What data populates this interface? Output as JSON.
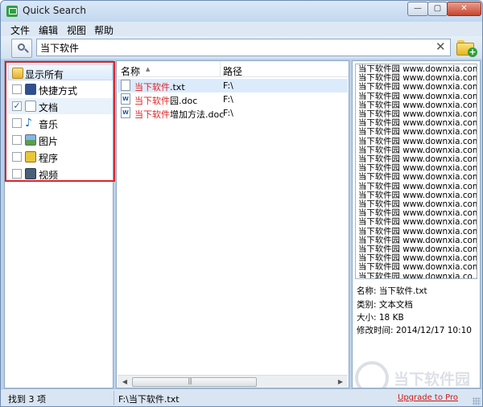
{
  "window": {
    "title": "Quick Search"
  },
  "window_buttons": {
    "min": "—",
    "max": "▢",
    "close": "✕"
  },
  "menu": [
    "文件",
    "编辑",
    "视图",
    "帮助"
  ],
  "search": {
    "value": "当下软件"
  },
  "categories": [
    {
      "label": "显示所有",
      "icon": "folder-icon",
      "checked": false
    },
    {
      "label": "快捷方式",
      "icon": "shortcut-icon",
      "checked": false
    },
    {
      "label": "文档",
      "icon": "document-icon",
      "checked": true
    },
    {
      "label": "音乐",
      "icon": "music-icon",
      "checked": false
    },
    {
      "label": "图片",
      "icon": "picture-icon",
      "checked": false
    },
    {
      "label": "程序",
      "icon": "program-icon",
      "checked": false
    },
    {
      "label": "视频",
      "icon": "video-icon",
      "checked": false
    }
  ],
  "results": {
    "col_name": "名称",
    "col_path": "路径",
    "rows": [
      {
        "highlight": "当下软件",
        "rest": ".txt",
        "path": "F:\\",
        "type": "txt",
        "selected": true
      },
      {
        "highlight": "当下软件",
        "rest": "园.doc",
        "path": "F:\\",
        "type": "doc",
        "selected": false
      },
      {
        "highlight": "当下软件",
        "rest": "增加方法.doc",
        "path": "F:\\",
        "type": "doc",
        "selected": false
      }
    ]
  },
  "preview": {
    "lines": [
      "当下软件园 www.downxia.com",
      "当下软件园 www.downxia.com",
      "当下软件园 www.downxia.com",
      "当下软件园 www.downxia.com",
      "当下软件园 www.downxia.com",
      "当下软件园 www.downxia.com",
      "当下软件园 www.downxia.com",
      "当下软件园 www.downxia.com",
      "当下软件园 www.downxia.com",
      "当下软件园 www.downxia.com",
      "当下软件园 www.downxia.com",
      "当下软件园 www.downxia.com",
      "当下软件园 www.downxia.com",
      "当下软件园 www.downxia.com",
      "当下软件园 www.downxia.com",
      "当下软件园 www.downxia.com",
      "当下软件园 www.downxia.com",
      "当下软件园 www.downxia.com",
      "当下软件园 www.downxia.com",
      "当下软件园 www.downxia.com",
      "当下软件园 www.downxia.com",
      "当下软件园 www.downxia.com",
      "当下软件园 www.downxia.com",
      "当下软件园 www.downxia.co..."
    ]
  },
  "info": [
    "名称: 当下软件.txt",
    "类别: 文本文档",
    "大小: 18 KB",
    "修改时间: 2014/12/17 10:10"
  ],
  "status": {
    "found": "找到 3 项",
    "path": "F:\\当下软件.txt",
    "upgrade": "Upgrade to Pro"
  },
  "watermark": {
    "text": "当下软件园"
  },
  "colors": {
    "highlight": "#e0201f",
    "category_frame": "#d8262d",
    "link": "#cc1a1a"
  }
}
